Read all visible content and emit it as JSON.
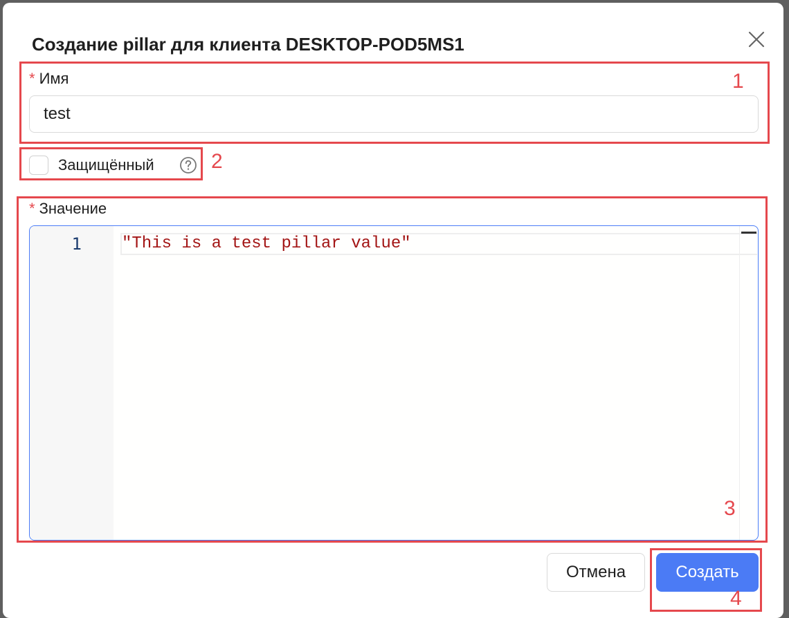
{
  "dialog": {
    "title": "Создание pillar для клиента DESKTOP-POD5MS1"
  },
  "name_field": {
    "required_mark": "*",
    "label": "Имя",
    "value": "test"
  },
  "protected": {
    "label": "Защищённый",
    "checked": false
  },
  "value_field": {
    "required_mark": "*",
    "label": "Значение",
    "line_number": "1",
    "code": "\"This is a test pillar value\""
  },
  "buttons": {
    "cancel": "Отмена",
    "create": "Создать"
  },
  "annotations": [
    "1",
    "2",
    "3",
    "4"
  ],
  "colors": {
    "primary": "#4b7bf5",
    "annotation": "#e5484d",
    "code_string": "#a31515"
  }
}
